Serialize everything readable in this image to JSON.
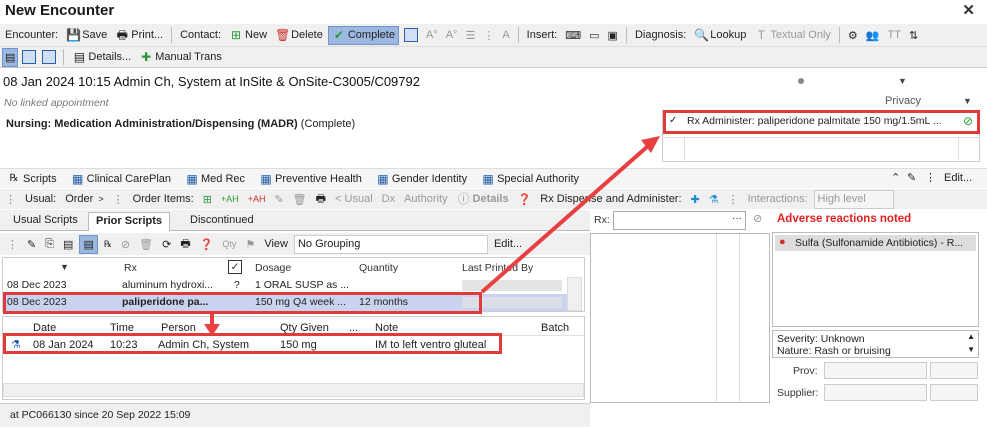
{
  "window": {
    "title": "New Encounter",
    "close_glyph": "✕"
  },
  "toolbar1": {
    "encounter_label": "Encounter:",
    "save": "Save",
    "print": "Print...",
    "contact_label": "Contact:",
    "new": "New",
    "delete": "Delete",
    "complete": "Complete",
    "insert_label": "Insert:",
    "diagnosis_label": "Diagnosis:",
    "lookup": "Lookup",
    "textual_only": "Textual Only"
  },
  "toolbar2": {
    "details": "Details...",
    "manual_trans": "Manual Trans"
  },
  "encounter": {
    "line": "08 Jan 2024 10:15 Admin Ch, System at InSite & OnSite-C3005/C09792",
    "no_link": "No linked appointment",
    "privacy": "Privacy",
    "nursing_bold": "Nursing: Medication Administration/Dispensing (MADR)",
    "nursing_status": "(Complete)",
    "rx_item": "Rx Administer: paliperidone palmitate 150 mg/1.5mL ..."
  },
  "tabs": {
    "scripts": "Scripts",
    "clinical_careplan": "Clinical CarePlan",
    "med_rec": "Med Rec",
    "preventive_health": "Preventive Health",
    "gender_identity": "Gender Identity",
    "special_authority": "Special Authority",
    "edit": "Edit..."
  },
  "order_bar": {
    "usual": "Usual:",
    "order": "Order",
    "order_items": "Order Items:",
    "usual_btn": "< Usual",
    "dx": "Dx",
    "authority": "Authority",
    "details": "Details",
    "rx_dispense": "Rx Dispense and Administer:",
    "interactions": "Interactions:",
    "interactions_value": "High level"
  },
  "subtabs": {
    "usual_scripts": "Usual Scripts",
    "prior_scripts": "Prior Scripts",
    "discontinued": "Discontinued"
  },
  "toolbar3": {
    "view_label": "View",
    "view_value": "No Grouping",
    "edit": "Edit..."
  },
  "scripts_grid": {
    "headers": [
      "Rx",
      "Dosage",
      "Quantity",
      "Last Printed By"
    ],
    "rows": [
      {
        "date": "08 Dec 2023",
        "rx": "aluminum hydroxi...",
        "flag": "?",
        "dosage": "1 ORAL SUSP as ...",
        "quantity": "",
        "printed": ""
      },
      {
        "date": "08 Dec 2023",
        "rx": "paliperidone pa...",
        "flag": "",
        "dosage": "150 mg Q4 week ...",
        "quantity": "12 months",
        "printed": ""
      }
    ]
  },
  "admin_grid": {
    "headers": [
      "Date",
      "Time",
      "Person",
      "Qty Given",
      "...",
      "Note",
      "Batch"
    ],
    "rows": [
      {
        "date": "08 Jan 2024",
        "time": "10:23",
        "person": "Admin Ch, System",
        "qty": "150 mg",
        "note": "IM to left ventro gluteal"
      }
    ]
  },
  "status": "at PC066130 since 20 Sep 2022 15:09",
  "right": {
    "rx_label": "Rx:",
    "adverse": "Adverse reactions noted",
    "allergy": "Sulfa (Sulfonamide Antibiotics) - R...",
    "severity": "Severity: Unknown",
    "nature": "Nature: Rash or bruising",
    "prov": "Prov:",
    "supplier": "Supplier:"
  },
  "colors": {
    "highlight_red": "#e03a3a",
    "active_blue": "#9cb8e0",
    "adverse_red": "#e02020"
  }
}
